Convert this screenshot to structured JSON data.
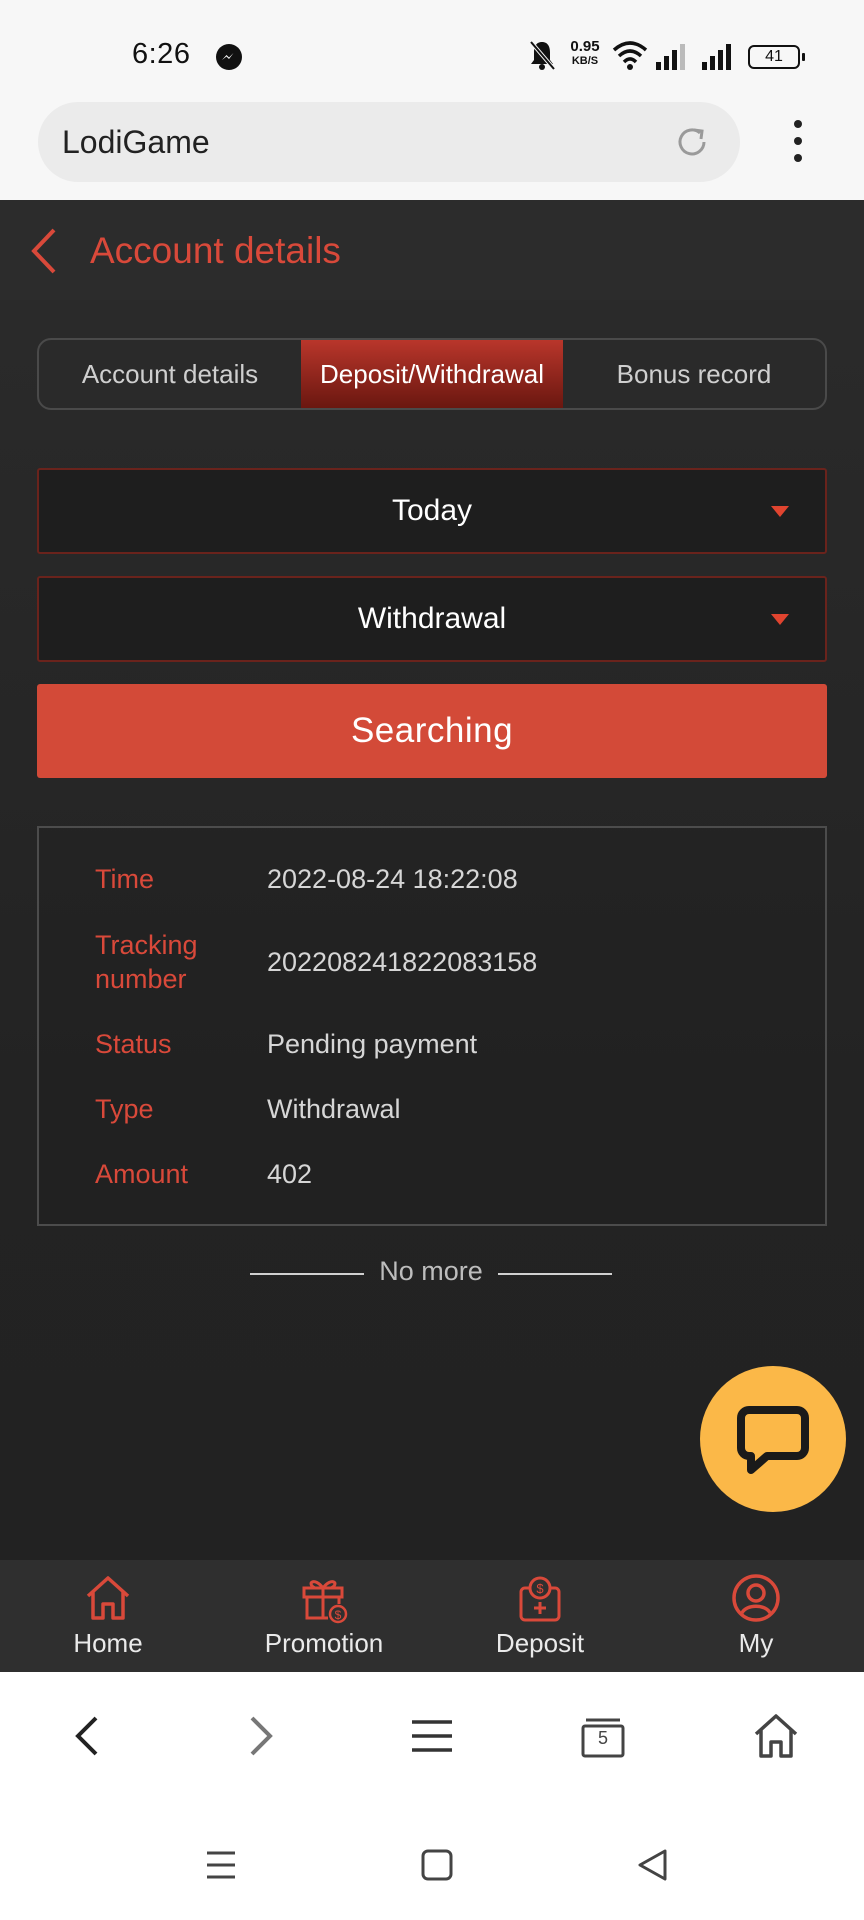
{
  "status_bar": {
    "time": "6:26",
    "net_speed_value": "0.95",
    "net_speed_unit": "KB/S",
    "battery": "41",
    "icons": [
      "messenger-icon",
      "bell-off-icon",
      "wifi-icon",
      "signal-icon",
      "signal-icon",
      "battery-icon"
    ]
  },
  "browser": {
    "url": "LodiGame",
    "tab_count": "5"
  },
  "header": {
    "title": "Account details"
  },
  "tabs": [
    {
      "label": "Account details",
      "active": false
    },
    {
      "label": "Deposit/Withdrawal",
      "active": true
    },
    {
      "label": "Bonus record",
      "active": false
    }
  ],
  "filters": {
    "date_range": "Today",
    "type": "Withdrawal"
  },
  "search_button": "Searching",
  "record": {
    "time_label": "Time",
    "time": "2022-08-24 18:22:08",
    "tracking_label": "Tracking number",
    "tracking": "202208241822083158",
    "status_label": "Status",
    "status": "Pending payment",
    "type_label": "Type",
    "type": "Withdrawal",
    "amount_label": "Amount",
    "amount": "402"
  },
  "list_end": "No more",
  "bottom_nav": [
    {
      "label": "Home",
      "icon": "home-icon"
    },
    {
      "label": "Promotion",
      "icon": "gift-icon"
    },
    {
      "label": "Deposit",
      "icon": "deposit-icon"
    },
    {
      "label": "My",
      "icon": "user-icon"
    }
  ],
  "colors": {
    "accent": "#d9493a",
    "button": "#d34a38",
    "background": "#252525",
    "chat_fab": "#fbb848"
  }
}
